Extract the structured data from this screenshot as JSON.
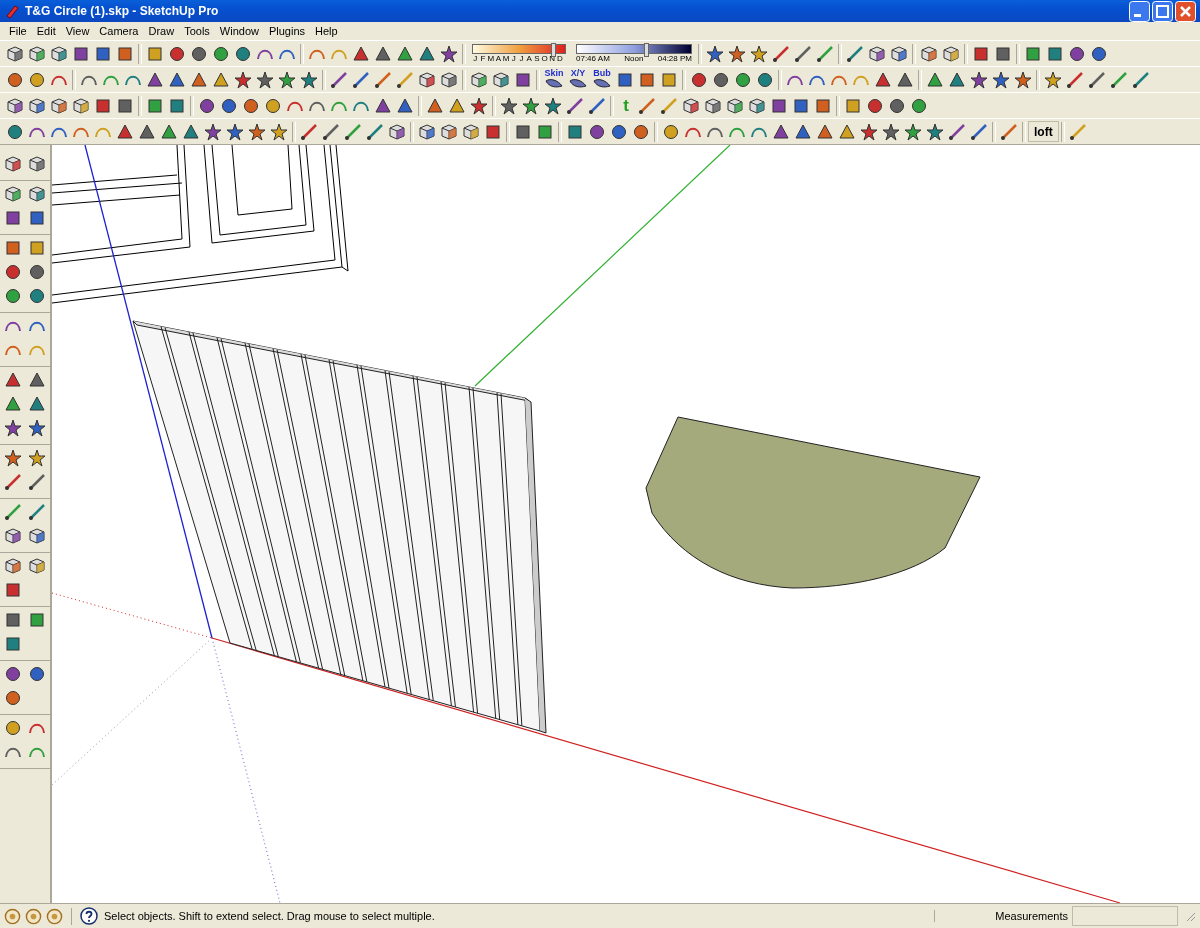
{
  "window": {
    "title": "T&G Circle (1).skp - SketchUp Pro"
  },
  "menu": [
    "File",
    "Edit",
    "View",
    "Camera",
    "Draw",
    "Tools",
    "Window",
    "Plugins",
    "Help"
  ],
  "toolbars": {
    "shadow": {
      "months": [
        "J",
        "F",
        "M",
        "A",
        "M",
        "J",
        "J",
        "A",
        "S",
        "O",
        "N",
        "D"
      ],
      "date_slider": {
        "level": 0.86
      },
      "times": [
        "07:46 AM",
        "Noon",
        "04:28 PM"
      ],
      "time_slider": {
        "level": 0.6
      }
    },
    "skin_buttons": [
      "Skin",
      "X/Y",
      "Bub"
    ],
    "text_tool": "t",
    "loft_button": "loft"
  },
  "status_bar": {
    "hint": "Select objects. Shift to extend select. Drag mouse to select multiple.",
    "measurements_label": "Measurements"
  }
}
